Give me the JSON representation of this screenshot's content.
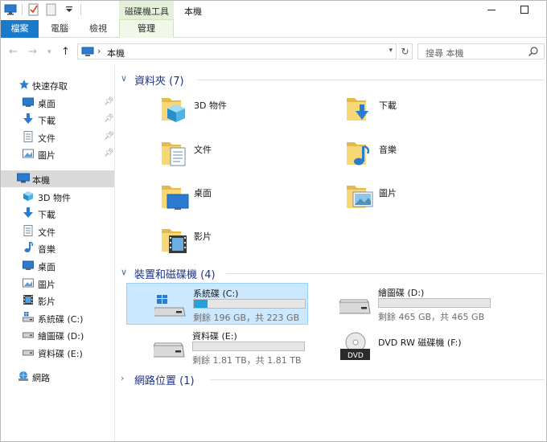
{
  "title_bar": {
    "contextual_tab": "磁碟機工具",
    "window_title": "本機"
  },
  "ribbon": {
    "tabs": [
      {
        "label": "檔案",
        "active": true
      },
      {
        "label": "電腦"
      },
      {
        "label": "檢視"
      },
      {
        "label": "管理"
      }
    ]
  },
  "address_bar": {
    "separator": "›",
    "location": "本機"
  },
  "search": {
    "placeholder": "搜尋 本機"
  },
  "nav_pane": {
    "quick_access": {
      "label": "快速存取",
      "items": [
        {
          "label": "桌面",
          "icon": "desktop-icon",
          "pinned": true
        },
        {
          "label": "下載",
          "icon": "download-icon",
          "pinned": true
        },
        {
          "label": "文件",
          "icon": "document-icon",
          "pinned": true
        },
        {
          "label": "圖片",
          "icon": "picture-icon",
          "pinned": true
        }
      ]
    },
    "this_pc": {
      "label": "本機",
      "items": [
        {
          "label": "3D 物件",
          "icon": "3d-objects-icon"
        },
        {
          "label": "下載",
          "icon": "download-icon"
        },
        {
          "label": "文件",
          "icon": "document-icon"
        },
        {
          "label": "音樂",
          "icon": "music-icon"
        },
        {
          "label": "桌面",
          "icon": "desktop-icon"
        },
        {
          "label": "圖片",
          "icon": "picture-icon"
        },
        {
          "label": "影片",
          "icon": "video-icon"
        },
        {
          "label": "系統碟 (C:)",
          "icon": "drive-icon"
        },
        {
          "label": "繪圖碟 (D:)",
          "icon": "drive-icon"
        },
        {
          "label": "資料碟 (E:)",
          "icon": "drive-icon"
        }
      ]
    },
    "network": {
      "label": "網路"
    }
  },
  "content": {
    "folders_group": {
      "title": "資料夾 (7)",
      "items": [
        {
          "label": "3D 物件",
          "icon": "3d-objects-folder-icon"
        },
        {
          "label": "下載",
          "icon": "download-folder-icon"
        },
        {
          "label": "文件",
          "icon": "document-folder-icon"
        },
        {
          "label": "音樂",
          "icon": "music-folder-icon"
        },
        {
          "label": "桌面",
          "icon": "desktop-folder-icon"
        },
        {
          "label": "圖片",
          "icon": "picture-folder-icon"
        },
        {
          "label": "影片",
          "icon": "video-folder-icon"
        }
      ]
    },
    "drives_group": {
      "title": "裝置和磁碟機 (4)",
      "items": [
        {
          "name": "系統碟 (C:)",
          "free_text": "剩餘 196 GB，共 223 GB",
          "used_fraction": 0.12,
          "selected": true
        },
        {
          "name": "繪圖碟 (D:)",
          "free_text": "剩餘 465 GB，共 465 GB",
          "used_fraction": 0.0
        },
        {
          "name": "資料碟 (E:)",
          "free_text": "剩餘 1.81 TB，共 1.81 TB",
          "used_fraction": 0.0
        },
        {
          "name": "DVD RW 磁碟機 (F:)",
          "icon": "dvd-drive-icon"
        }
      ]
    },
    "network_group": {
      "title": "網路位置 (1)"
    }
  },
  "colors": {
    "accent": "#1979ca",
    "selection": "#cce8ff",
    "bar_fill": "#26a0da",
    "group_title": "#1e3287",
    "folder_yellow": "#f8d775"
  }
}
